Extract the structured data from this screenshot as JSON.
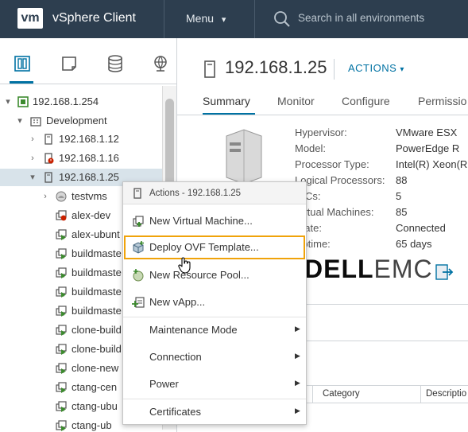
{
  "header": {
    "logo": "vm",
    "app_title": "vSphere Client",
    "menu_label": "Menu",
    "search_placeholder": "Search in all environments"
  },
  "nav": {
    "tabs": [
      "hosts-and-clusters-icon",
      "vms-and-templates-icon",
      "storage-icon",
      "networking-icon"
    ],
    "active_tab": 0
  },
  "tree": [
    {
      "label": "192.168.1.254",
      "icon": "vcenter-icon",
      "expander": "▾"
    },
    {
      "label": "Development",
      "icon": "datacenter-icon",
      "expander": "▾"
    },
    {
      "label": "192.168.1.12",
      "icon": "host-icon",
      "expander": "›"
    },
    {
      "label": "192.168.1.16",
      "icon": "host-alert-icon",
      "expander": "›"
    },
    {
      "label": "192.168.1.25",
      "icon": "host-icon",
      "expander": "▾",
      "selected": true
    },
    {
      "label": "testvms",
      "icon": "resource-pool-icon",
      "expander": "›"
    },
    {
      "label": "alex-dev",
      "icon": "vm-alert-icon"
    },
    {
      "label": "alex-ubunt",
      "icon": "vm-on-icon"
    },
    {
      "label": "buildmaste",
      "icon": "vm-on-icon"
    },
    {
      "label": "buildmaste",
      "icon": "vm-on-icon"
    },
    {
      "label": "buildmaste",
      "icon": "vm-on-icon"
    },
    {
      "label": "buildmaste",
      "icon": "vm-on-icon"
    },
    {
      "label": "clone-build",
      "icon": "vm-on-icon"
    },
    {
      "label": "clone-build",
      "icon": "vm-on-icon"
    },
    {
      "label": "clone-new",
      "icon": "vm-on-icon"
    },
    {
      "label": "ctang-cen",
      "icon": "vm-on-icon"
    },
    {
      "label": "ctang-ubu",
      "icon": "vm-on-icon"
    },
    {
      "label": "ctang-ub",
      "icon": "vm-on-icon"
    }
  ],
  "main": {
    "host_title": "192.168.1.25",
    "actions_label": "ACTIONS",
    "tabs": [
      "Summary",
      "Monitor",
      "Configure",
      "Permissio"
    ],
    "active_tab": "Summary",
    "summary": [
      {
        "key": "Hypervisor:",
        "value": "VMware ESX"
      },
      {
        "key": "Model:",
        "value": "PowerEdge R"
      },
      {
        "key": "Processor Type:",
        "value": "Intel(R) Xeon(R"
      },
      {
        "key": "Logical Processors:",
        "value": "88"
      },
      {
        "key": "NICs:",
        "value": "5"
      },
      {
        "key": "Virtual Machines:",
        "value": "85"
      },
      {
        "key": "State:",
        "value": "Connected"
      },
      {
        "key": "Uptime:",
        "value": "65 days"
      }
    ],
    "vendor_logo": {
      "dell": "DELL",
      "emc": "EMC"
    },
    "table_headers": [
      "Category",
      "Descriptio"
    ]
  },
  "context_menu": {
    "header": "Actions - 192.168.1.25",
    "items": [
      {
        "label": "New Virtual Machine...",
        "icon": "new-vm-icon"
      },
      {
        "label": "Deploy OVF Template...",
        "icon": "deploy-ovf-icon",
        "highlighted": true
      },
      {
        "label": "New Resource Pool...",
        "icon": "new-resource-pool-icon"
      },
      {
        "label": "New vApp...",
        "icon": "new-vapp-icon"
      },
      {
        "label": "Maintenance Mode",
        "submenu": true
      },
      {
        "label": "Connection",
        "submenu": true
      },
      {
        "label": "Power",
        "submenu": true
      },
      {
        "label": "Certificates",
        "submenu": true
      }
    ]
  },
  "colors": {
    "header_bg": "#2d3e4f",
    "accent": "#0072a3",
    "highlight_outline": "#f0a30a",
    "selected_row": "#d8e3ea"
  }
}
